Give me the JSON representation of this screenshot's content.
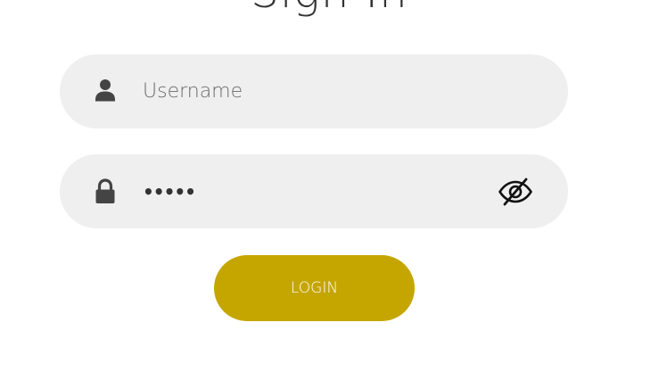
{
  "title": "Sign In",
  "username": {
    "placeholder": "Username",
    "value": "",
    "icon": "user-icon"
  },
  "password": {
    "masked_value": "•••••",
    "icon": "lock-icon",
    "toggle_icon": "eye-off-icon"
  },
  "login_button": {
    "label": "LOGIN"
  },
  "colors": {
    "accent": "#c5a600",
    "field_background": "#efefef",
    "icon": "#444444",
    "title_text": "#333333"
  }
}
